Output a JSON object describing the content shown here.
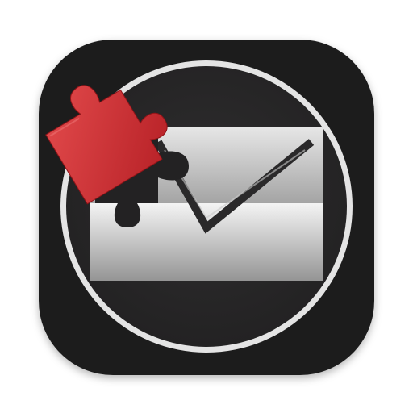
{
  "app_icon": {
    "icon": "mail-plugin-icon",
    "parts": {
      "background": "rounded-square-icon-background",
      "ring": "circular-badge-ring",
      "envelope": "envelope-icon",
      "puzzle": "puzzle-piece-icon"
    },
    "colors": {
      "page_background": "#ffffff",
      "tile": "#1f1e1f",
      "disc": "#2a292a",
      "ring": "#e4e4e4",
      "envelope_light": "#f2f2f2",
      "envelope_dark": "#9a9a9a",
      "puzzle_red": "#c8282c",
      "puzzle_red_light": "#e2484a"
    }
  }
}
